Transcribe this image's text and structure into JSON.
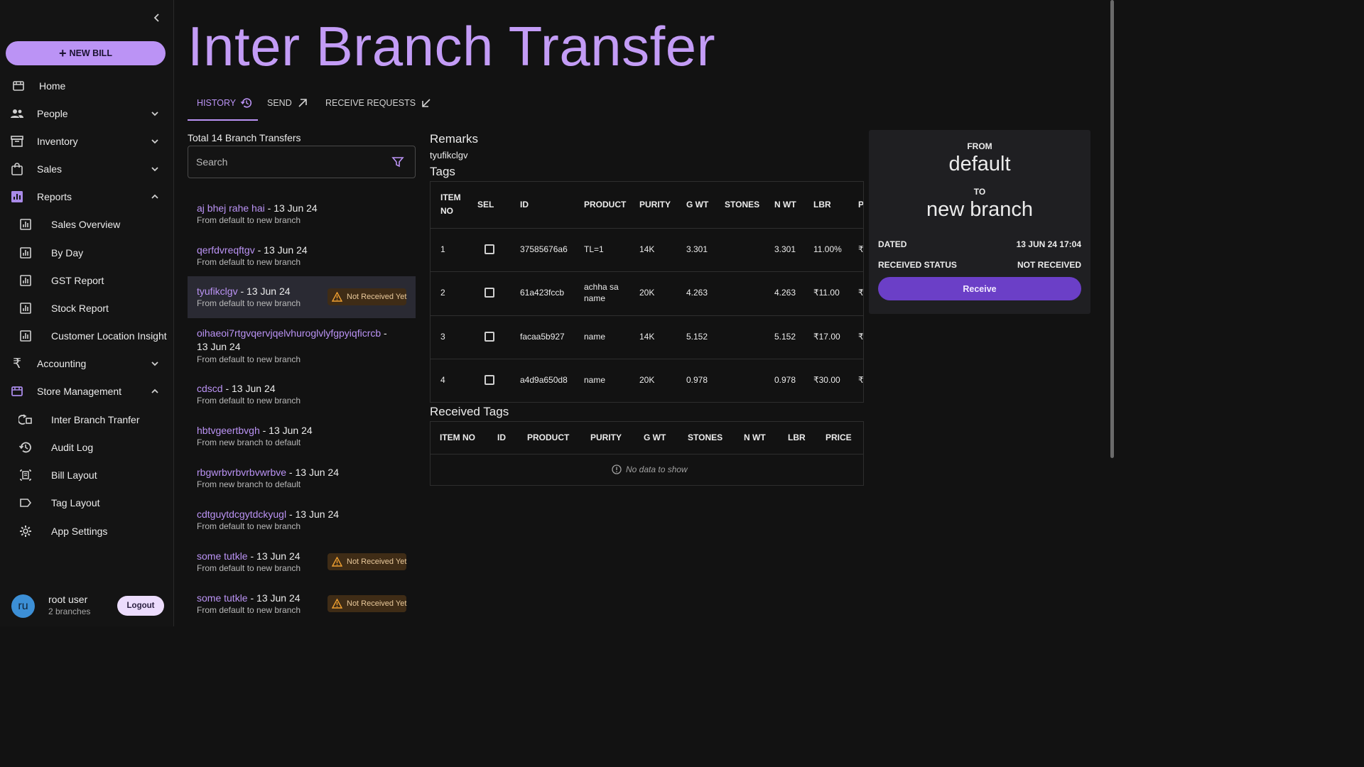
{
  "sidebar": {
    "new_bill_label": "NEW BILL",
    "items": [
      {
        "label": "Home"
      },
      {
        "label": "People"
      },
      {
        "label": "Inventory"
      },
      {
        "label": "Sales"
      },
      {
        "label": "Reports"
      },
      {
        "label": "Sales Overview"
      },
      {
        "label": "By Day"
      },
      {
        "label": "GST Report"
      },
      {
        "label": "Stock Report"
      },
      {
        "label": "Customer Location Insight"
      },
      {
        "label": "Accounting"
      },
      {
        "label": "Store Management"
      },
      {
        "label": "Inter Branch Tranfer"
      },
      {
        "label": "Audit Log"
      },
      {
        "label": "Bill Layout"
      },
      {
        "label": "Tag Layout"
      },
      {
        "label": "App Settings"
      }
    ],
    "user": {
      "initials": "ru",
      "name": "root user",
      "branches": "2 branches",
      "logout_label": "Logout"
    }
  },
  "page": {
    "title": "Inter Branch Transfer"
  },
  "tabs": [
    {
      "label": "HISTORY",
      "icon": "history-icon"
    },
    {
      "label": "SEND",
      "icon": "arrow-up-right-icon"
    },
    {
      "label": "RECEIVE REQUESTS",
      "icon": "arrow-down-left-icon"
    }
  ],
  "history": {
    "total_label": "Total 14 Branch Transfers",
    "search_placeholder": "Search",
    "badge_label": "Not Received Yet",
    "items": [
      {
        "name": "aj bhej rahe hai",
        "date": " - 13 Jun 24",
        "route": "From default to new branch",
        "not_received": false
      },
      {
        "name": "qerfdvreqftgv",
        "date": " - 13 Jun 24",
        "route": "From default to new branch",
        "not_received": false
      },
      {
        "name": "tyufikclgv",
        "date": " - 13 Jun 24",
        "route": "From default to new branch",
        "not_received": true
      },
      {
        "name": "oihaeoi7rtgvqervjqelvhuroglvlyfgpyiqficrcb",
        "date": " - 13 Jun 24",
        "route": "From default to new branch",
        "not_received": false
      },
      {
        "name": "cdscd",
        "date": " - 13 Jun 24",
        "route": "From default to new branch",
        "not_received": false
      },
      {
        "name": "hbtvgeertbvgh",
        "date": " - 13 Jun 24",
        "route": "From new branch to default",
        "not_received": false
      },
      {
        "name": "rbgwrbvrbvrbvwrbve",
        "date": " - 13 Jun 24",
        "route": "From new branch to default",
        "not_received": false
      },
      {
        "name": "cdtguytdcgytdckyugl",
        "date": " - 13 Jun 24",
        "route": "From default to new branch",
        "not_received": false
      },
      {
        "name": "some tutkle",
        "date": " - 13 Jun 24",
        "route": "From default to new branch",
        "not_received": true
      },
      {
        "name": "some tutkle",
        "date": " - 13 Jun 24",
        "route": "From default to new branch",
        "not_received": true
      }
    ]
  },
  "detail": {
    "remarks_heading": "Remarks",
    "remarks_value": "tyufikclgv",
    "tags_heading": "Tags",
    "tags_columns": [
      "ITEM NO",
      "SEL",
      "ID",
      "PRODUCT",
      "PURITY",
      "G WT",
      "STONES",
      "N WT",
      "LBR",
      "P"
    ],
    "tags_rows": [
      {
        "item_no": "1",
        "id": "37585676a6",
        "product": "TL=1",
        "purity": "14K",
        "gwt": "3.301",
        "stones": "",
        "nwt": "3.301",
        "lbr": "11.00%",
        "price": "₹"
      },
      {
        "item_no": "2",
        "id": "61a423fccb",
        "product": "achha sa name",
        "purity": "20K",
        "gwt": "4.263",
        "stones": "",
        "nwt": "4.263",
        "lbr": "₹11.00",
        "price": "₹"
      },
      {
        "item_no": "3",
        "id": "facaa5b927",
        "product": "name",
        "purity": "14K",
        "gwt": "5.152",
        "stones": "",
        "nwt": "5.152",
        "lbr": "₹17.00",
        "price": "₹"
      },
      {
        "item_no": "4",
        "id": "a4d9a650d8",
        "product": "name",
        "purity": "20K",
        "gwt": "0.978",
        "stones": "",
        "nwt": "0.978",
        "lbr": "₹30.00",
        "price": "₹"
      }
    ],
    "received_heading": "Received Tags",
    "received_columns": [
      "ITEM NO",
      "ID",
      "PRODUCT",
      "PURITY",
      "G WT",
      "STONES",
      "N WT",
      "LBR",
      "PRICE"
    ],
    "no_data": "No data to show"
  },
  "info": {
    "from_label": "FROM",
    "from_branch": "default",
    "to_label": "TO",
    "to_branch": "new branch",
    "dated_label": "DATED",
    "dated_value": "13 JUN 24 17:04",
    "status_label": "RECEIVED STATUS",
    "status_value": "NOT RECEIVED",
    "receive_label": "Receive"
  },
  "colors": {
    "accent": "#bb93f5",
    "button": "#6b3fc7",
    "badge_bg": "#3f2c16",
    "badge_text": "#e8c89a"
  }
}
